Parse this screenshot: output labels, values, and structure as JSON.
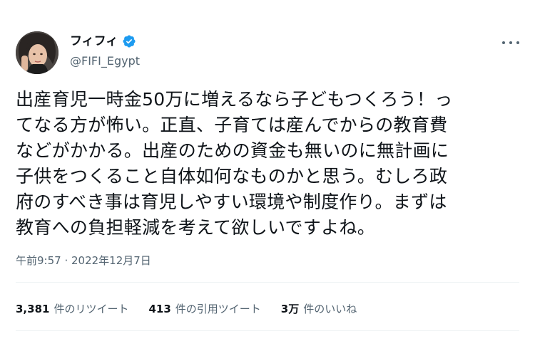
{
  "author": {
    "display_name": "フィフィ",
    "handle": "@FIFI_Egypt",
    "verified": true
  },
  "tweet": {
    "text": "出産育児一時金50万に増えるなら子どもつくろう！っ\nてなる方が怖い。正直、子育ては産んでからの教育費\nなどがかかる。出産のための資金も無いのに無計画に\n子供をつくること自体如何なものかと思う。むしろ政\n府のすべき事は育児しやすい環境や制度作り。まずは\n教育への負担軽減を考えて欲しいですよね。",
    "timestamp": "午前9:57 · 2022年12月7日"
  },
  "stats": {
    "retweets": {
      "count": "3,381",
      "label": "件のリツイート"
    },
    "quotes": {
      "count": "413",
      "label": "件の引用ツイート"
    },
    "likes": {
      "count": "3万",
      "label": "件のいいね"
    }
  },
  "colors": {
    "verified_badge": "#1d9bf0",
    "secondary_text": "#536471",
    "primary_text": "#0f1419"
  },
  "icons": {
    "avatar": "avatar",
    "verified": "verified-badge-icon",
    "more": "more-options-icon"
  }
}
